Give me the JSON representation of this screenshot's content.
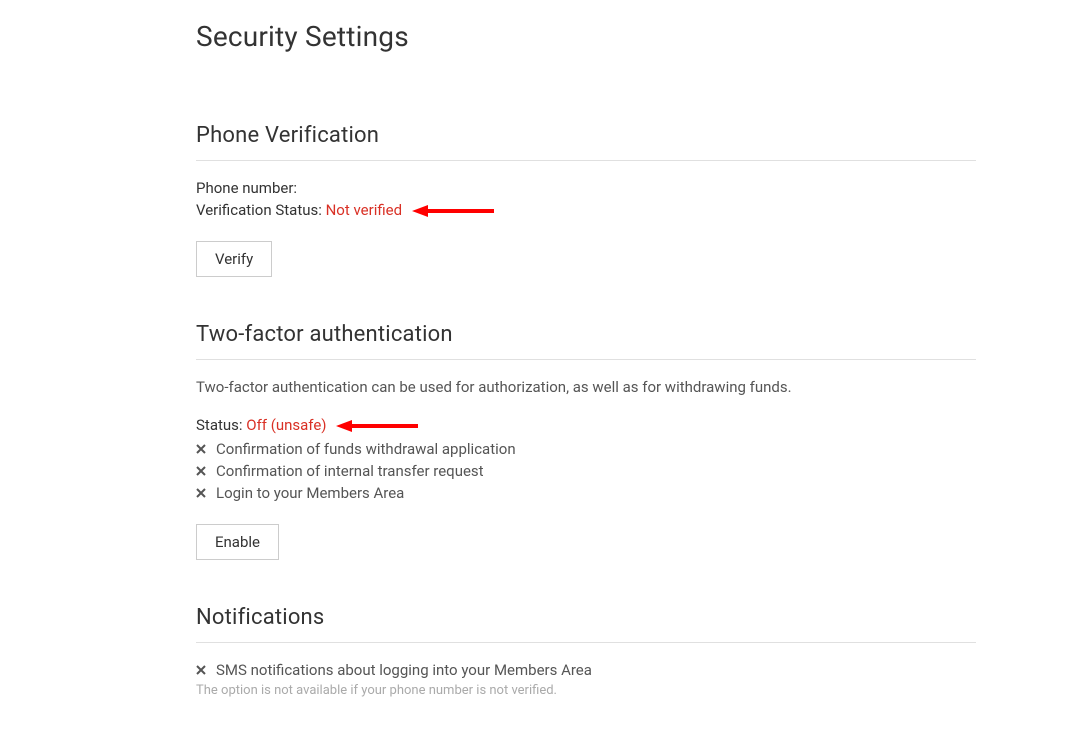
{
  "pageTitle": "Security Settings",
  "phoneVerification": {
    "title": "Phone Verification",
    "phoneLabel": "Phone number:",
    "phoneValue": "",
    "statusLabel": "Verification Status: ",
    "statusValue": "Not verified",
    "buttonLabel": "Verify"
  },
  "twoFactor": {
    "title": "Two-factor authentication",
    "description": "Two-factor authentication can be used for authorization, as well as for withdrawing funds.",
    "statusLabel": "Status: ",
    "statusValue": "Off (unsafe)",
    "features": [
      "Confirmation of funds withdrawal application",
      "Confirmation of internal transfer request",
      "Login to your Members Area"
    ],
    "buttonLabel": "Enable"
  },
  "notifications": {
    "title": "Notifications",
    "item": "SMS notifications about logging into your Members Area",
    "helper": "The option is not available if your phone number is not verified."
  },
  "colors": {
    "statusRed": "#d93025"
  }
}
